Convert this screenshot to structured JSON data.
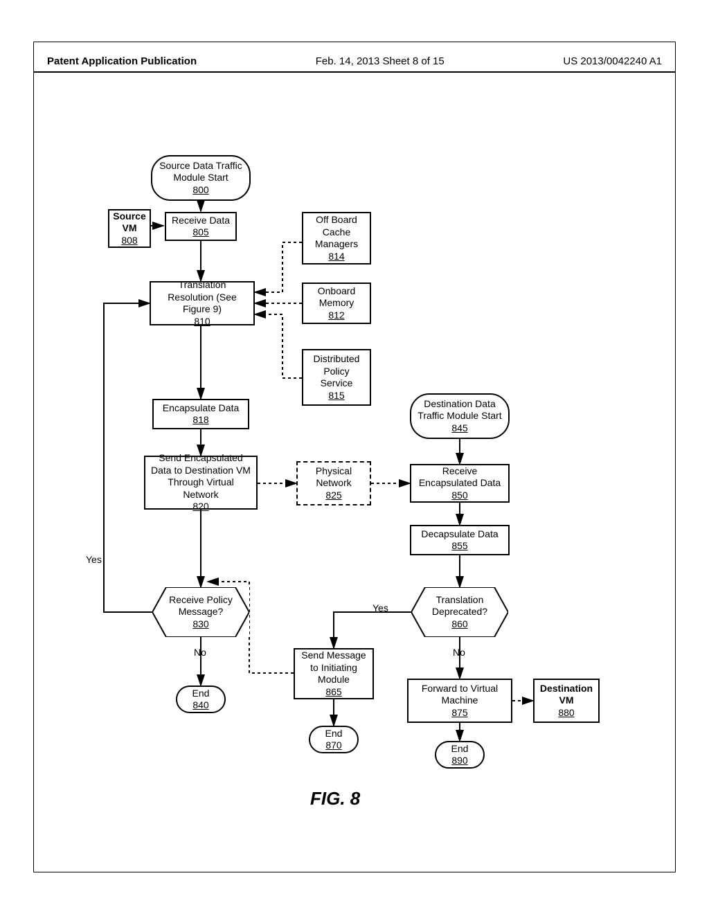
{
  "header": {
    "left": "Patent Application Publication",
    "center": "Feb. 14, 2013  Sheet 8 of 15",
    "right": "US 2013/0042240 A1"
  },
  "nodes": {
    "start_src": {
      "title": "Source Data Traffic Module Start",
      "ref": "800"
    },
    "source_vm": {
      "title": "Source VM",
      "ref": "808"
    },
    "receive_data": {
      "title": "Receive Data",
      "ref": "805"
    },
    "offboard": {
      "title": "Off Board Cache Managers",
      "ref": "814"
    },
    "translation": {
      "title": "Translation Resolution (See Figure 9)",
      "ref": "810"
    },
    "onboard": {
      "title": "Onboard Memory",
      "ref": "812"
    },
    "dps": {
      "title": "Distributed Policy Service",
      "ref": "815"
    },
    "encap": {
      "title": "Encapsulate Data",
      "ref": "818"
    },
    "start_dst": {
      "title": "Destination Data Traffic Module Start",
      "ref": "845"
    },
    "send_encap": {
      "title": "Send Encapsulated Data to Destination VM Through Virtual Network",
      "ref": "820"
    },
    "physnet": {
      "title": "Physical Network",
      "ref": "825"
    },
    "recv_encap": {
      "title": "Receive Encapsulated Data",
      "ref": "850"
    },
    "decap": {
      "title": "Decapsulate Data",
      "ref": "855"
    },
    "dec_policy": {
      "title": "Receive Policy Message?",
      "ref": "830"
    },
    "dec_deprec": {
      "title": "Translation Deprecated?",
      "ref": "860"
    },
    "send_msg": {
      "title": "Send Message to Initiating Module",
      "ref": "865"
    },
    "fwd_vm": {
      "title": "Forward to Virtual Machine",
      "ref": "875"
    },
    "dest_vm": {
      "title": "Destination VM",
      "ref": "880"
    },
    "end840": {
      "title": "End",
      "ref": "840"
    },
    "end870": {
      "title": "End",
      "ref": "870"
    },
    "end890": {
      "title": "End",
      "ref": "890"
    }
  },
  "labels": {
    "yes_left": "Yes",
    "no_mid": "No",
    "yes_mid": "Yes",
    "no_right": "No"
  },
  "caption": "FIG. 8"
}
